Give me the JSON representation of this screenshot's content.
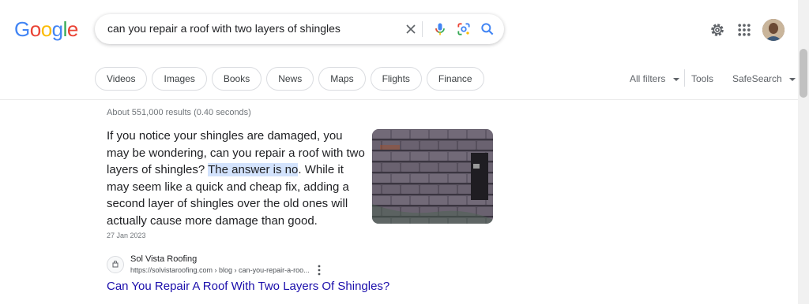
{
  "logo": {
    "letters": [
      "G",
      "o",
      "o",
      "g",
      "l",
      "e"
    ]
  },
  "search": {
    "query": "can you repair a roof with two layers of shingles"
  },
  "chips": [
    "Videos",
    "Images",
    "Books",
    "News",
    "Maps",
    "Flights",
    "Finance"
  ],
  "filters": {
    "all_filters": "All filters",
    "tools": "Tools",
    "safesearch": "SafeSearch"
  },
  "stats": "About 551,000 results (0.40 seconds)",
  "snippet": {
    "before": "If you notice your shingles are damaged, you may be wondering, can you repair a roof with two layers of shingles? ",
    "highlight": "The answer is no",
    "after": ". While it may seem like a quick and cheap fix, adding a second layer of shingles over the old ones will actually cause more damage than good."
  },
  "date": "27 Jan 2023",
  "result": {
    "site_name": "Sol Vista Roofing",
    "url": "https://solvistaroofing.com › blog › can-you-repair-a-roo...",
    "title": "Can You Repair A Roof With Two Layers Of Shingles?"
  },
  "colors": {
    "link": "#1a0dab",
    "highlight": "#d3e3fd",
    "blue": "#4285f4",
    "red": "#ea4335",
    "yellow": "#fbbc05",
    "green": "#34a853"
  },
  "icons": [
    "close-icon",
    "microphone-icon",
    "google-lens-icon",
    "search-icon",
    "settings-icon",
    "apps-grid-icon",
    "avatar",
    "favicon",
    "more-options-icon",
    "caret-down-icon"
  ]
}
